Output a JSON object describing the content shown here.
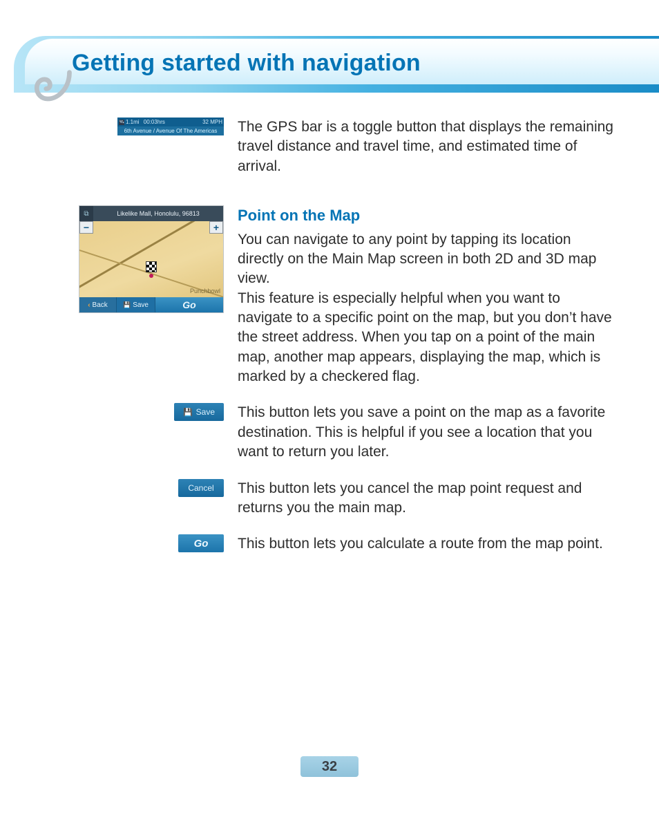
{
  "page": {
    "title": "Getting started with navigation",
    "number": "32"
  },
  "gps_bar": {
    "sat_glyph": "🛰",
    "distance": "1.1mi",
    "duration": "00:03hrs",
    "speed": "32 MPH",
    "street": "6th Avenue / Avenue Of The Americas",
    "desc": "The GPS bar is a toggle button that displays the remaining travel distance and travel time, and estimated time of arrival."
  },
  "point_on_map": {
    "heading": "Point on the Map",
    "text": "You can navigate to any point by tapping its location directly on the Main Map screen in both 2D and 3D map view.\nThis feature is especially helpful when you want to navigate to a specific point on the map, but you don’t have the street address. When you tap on a point of the main map, another map appears, displaying the map, which is marked by a checkered flag.",
    "screenshot": {
      "address": "Likelike Mall, Honolulu, 96813",
      "back": "Back",
      "save": "Save",
      "go": "Go",
      "zoom_in": "+",
      "zoom_out": "−",
      "view_icon": "⧉",
      "area_label": "Punchbowl"
    }
  },
  "buttons": {
    "save": {
      "label": "Save",
      "desc": "This button lets you save a point on the map as a favorite destination. This is helpful if you see a location that you want to return you later."
    },
    "cancel": {
      "label": "Cancel",
      "desc": "This button lets you cancel the map point request and returns you the main map."
    },
    "go": {
      "label": "Go",
      "desc": "This button lets you calculate a route from the map point."
    }
  }
}
